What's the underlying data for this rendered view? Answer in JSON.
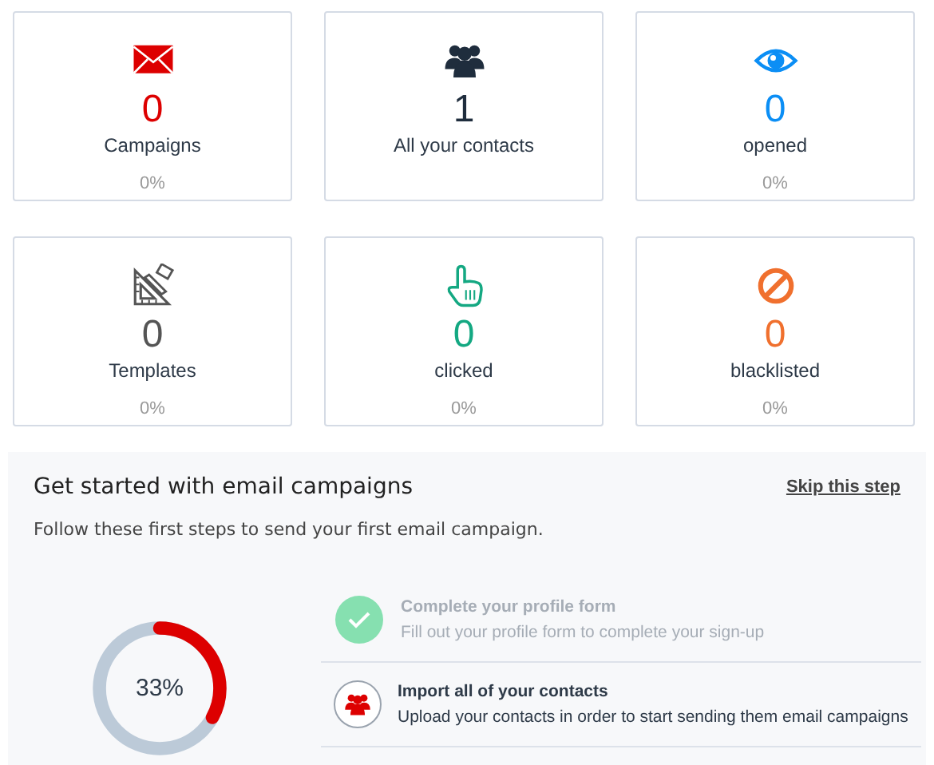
{
  "stats": [
    {
      "kind": "envelope",
      "color": "#dd0000",
      "value": "0",
      "label": "Campaigns",
      "percent": "0%"
    },
    {
      "kind": "group",
      "color": "#1f2d3d",
      "value": "1",
      "label": "All your contacts"
    },
    {
      "kind": "eye",
      "color": "#0b8ef5",
      "value": "0",
      "label": "opened",
      "percent": "0%"
    },
    {
      "kind": "tools",
      "color": "#555555",
      "value": "0",
      "label": "Templates",
      "percent": "0%"
    },
    {
      "kind": "hand",
      "color": "#14a882",
      "value": "0",
      "label": "clicked",
      "percent": "0%"
    },
    {
      "kind": "ban",
      "color": "#f0702e",
      "value": "0",
      "label": "blacklisted",
      "percent": "0%"
    }
  ],
  "onboarding": {
    "title": "Get started with email campaigns",
    "skip": "Skip this step",
    "subtitle": "Follow these first steps to send your first email campaign.",
    "progress": {
      "level": 0.33,
      "reading": "33%"
    },
    "steps": [
      {
        "kind": "check",
        "done": true,
        "title": "Complete your profile form",
        "text": "Fill out your profile form to complete your sign-up"
      },
      {
        "kind": "group",
        "done": false,
        "title": "Import all of your contacts",
        "text": "Upload your contacts in order to start sending them email campaigns"
      }
    ]
  }
}
